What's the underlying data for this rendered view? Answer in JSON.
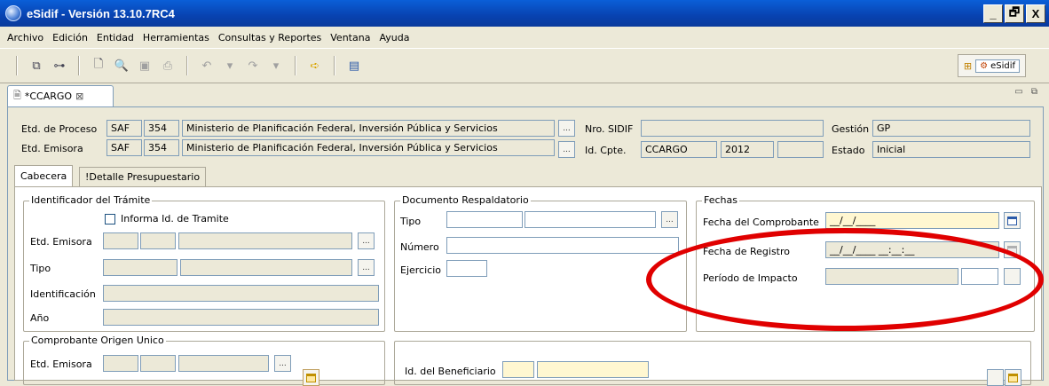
{
  "window": {
    "title": "eSidif - Versión 13.10.7RC4",
    "min": "_",
    "max": "🗗",
    "close": "X"
  },
  "menu": [
    "Archivo",
    "Edición",
    "Entidad",
    "Herramientas",
    "Consultas y Reportes",
    "Ventana",
    "Ayuda"
  ],
  "perspective": {
    "label": "eSidif"
  },
  "editor_tab": {
    "label": "*CCARGO",
    "close": "⊠"
  },
  "header": {
    "etd_proceso_label": "Etd. de Proceso",
    "etd_proceso_saf": "SAF",
    "etd_proceso_code": "354",
    "etd_proceso_name": "Ministerio de Planificación Federal, Inversión Pública y Servicios",
    "etd_emisora_label": "Etd. Emisora",
    "etd_emisora_saf": "SAF",
    "etd_emisora_code": "354",
    "etd_emisora_name": "Ministerio de Planificación Federal, Inversión Pública y Servicios",
    "nro_sidif_label": "Nro. SIDIF",
    "nro_sidif_value": "",
    "id_cpte_label": "Id. Cpte.",
    "id_cpte_type": "CCARGO",
    "id_cpte_year": "2012",
    "id_cpte_num": "",
    "gestion_label": "Gestión",
    "gestion_value": "GP",
    "estado_label": "Estado",
    "estado_value": "Inicial",
    "ellipsis": "..."
  },
  "subtabs": [
    "Cabecera",
    "!Detalle Presupuestario"
  ],
  "identificador": {
    "legend": "Identificador del Trámite",
    "informa_label": "Informa Id. de Tramite",
    "etd_emisora_label": "Etd. Emisora",
    "tipo_label": "Tipo",
    "identificacion_label": "Identificación",
    "anio_label": "Año"
  },
  "documento": {
    "legend": "Documento Respaldatorio",
    "tipo_label": "Tipo",
    "numero_label": "Número",
    "ejercicio_label": "Ejercicio"
  },
  "fechas": {
    "legend": "Fechas",
    "comprobante_label": "Fecha del Comprobante",
    "comprobante_value": "__/__/____",
    "registro_label": "Fecha de Registro",
    "registro_value": "__/__/____ __:__:__",
    "periodo_label": "Período de Impacto",
    "periodo_value": ""
  },
  "origen": {
    "legend": "Comprobante Origen Unico",
    "etd_emisora_label": "Etd. Emisora"
  },
  "beneficiario": {
    "label": "Id. del Beneficiario"
  },
  "colors": {
    "highlight": "#e00000",
    "required": "#fff7d1"
  }
}
